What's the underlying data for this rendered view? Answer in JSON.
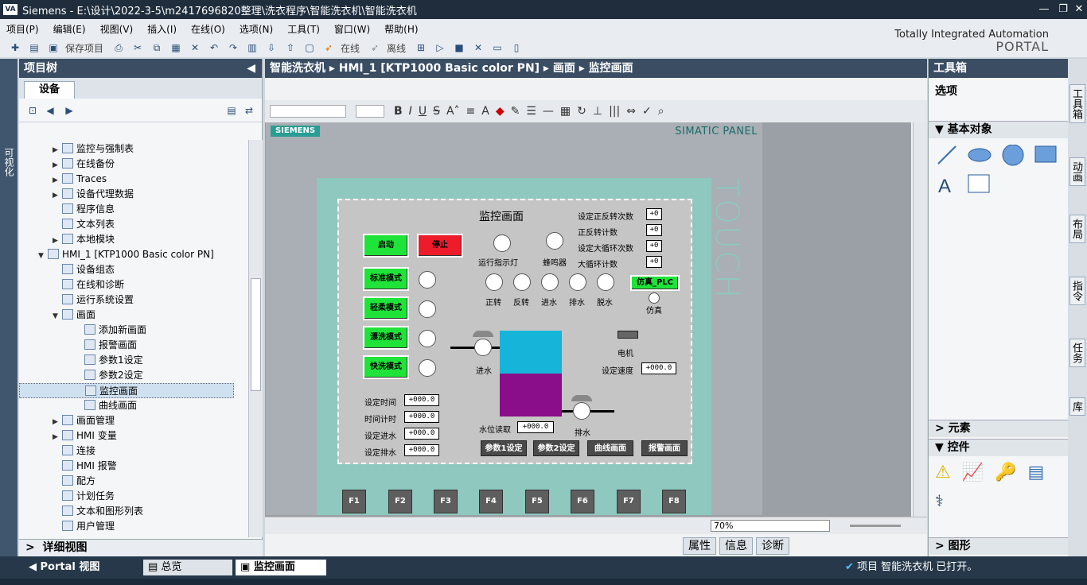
{
  "window": {
    "title": "Siemens  -  E:\\设计\\2022-3-5\\m2417696820整理\\洗衣程序\\智能洗衣机\\智能洗衣机",
    "logo": "VA"
  },
  "menu": [
    "项目(P)",
    "编辑(E)",
    "视图(V)",
    "插入(I)",
    "在线(O)",
    "选项(N)",
    "工具(T)",
    "窗口(W)",
    "帮助(H)"
  ],
  "toolbar": {
    "save_project": "保存项目",
    "online": "在线",
    "offline": "离线"
  },
  "tia": {
    "line1": "Totally Integrated Automation",
    "line2": "PORTAL"
  },
  "left_strip_label": "可视化",
  "project_tree": {
    "title": "项目树",
    "tab": "设备",
    "items": [
      {
        "label": "监控与强制表",
        "level": 2,
        "arrow": "▶"
      },
      {
        "label": "在线备份",
        "level": 2,
        "arrow": "▶"
      },
      {
        "label": "Traces",
        "level": 2,
        "arrow": "▶"
      },
      {
        "label": "设备代理数据",
        "level": 2,
        "arrow": "▶"
      },
      {
        "label": "程序信息",
        "level": 2,
        "arrow": ""
      },
      {
        "label": "文本列表",
        "level": 2,
        "arrow": ""
      },
      {
        "label": "本地模块",
        "level": 2,
        "arrow": "▶"
      },
      {
        "label": "HMI_1 [KTP1000 Basic color PN]",
        "level": 1,
        "arrow": "▼"
      },
      {
        "label": "设备组态",
        "level": 2,
        "arrow": ""
      },
      {
        "label": "在线和诊断",
        "level": 2,
        "arrow": ""
      },
      {
        "label": "运行系统设置",
        "level": 2,
        "arrow": ""
      },
      {
        "label": "画面",
        "level": 2,
        "arrow": "▼"
      },
      {
        "label": "添加新画面",
        "level": 3,
        "arrow": ""
      },
      {
        "label": "报警画面",
        "level": 3,
        "arrow": ""
      },
      {
        "label": "参数1设定",
        "level": 3,
        "arrow": ""
      },
      {
        "label": "参数2设定",
        "level": 3,
        "arrow": ""
      },
      {
        "label": "监控画面",
        "level": 3,
        "arrow": "",
        "selected": true
      },
      {
        "label": "曲线画面",
        "level": 3,
        "arrow": ""
      },
      {
        "label": "画面管理",
        "level": 2,
        "arrow": "▶"
      },
      {
        "label": "HMI 变量",
        "level": 2,
        "arrow": "▶"
      },
      {
        "label": "连接",
        "level": 2,
        "arrow": ""
      },
      {
        "label": "HMI 报警",
        "level": 2,
        "arrow": ""
      },
      {
        "label": "配方",
        "level": 2,
        "arrow": ""
      },
      {
        "label": "计划任务",
        "level": 2,
        "arrow": ""
      },
      {
        "label": "文本和图形列表",
        "level": 2,
        "arrow": ""
      },
      {
        "label": "用户管理",
        "level": 2,
        "arrow": ""
      }
    ]
  },
  "detail_view": "详细视图",
  "breadcrumb": [
    "智能洗衣机",
    "HMI_1 [KTP1000 Basic color PN]",
    "画面",
    "监控画面"
  ],
  "panel": {
    "brand": "SIEMENS",
    "model": "SIMATIC PANEL",
    "touch": "TOUCH",
    "fkeys": [
      "F1",
      "F2",
      "F3",
      "F4",
      "F5",
      "F6",
      "F7",
      "F8"
    ]
  },
  "hmi": {
    "title": "监控画面",
    "btn_start": "启动",
    "btn_stop": "停止",
    "modes": [
      "标准模式",
      "轻柔模式",
      "漂洗模式",
      "快洗模式"
    ],
    "run_light": "运行指示灯",
    "buzzer": "蜂鸣器",
    "states": [
      "正转",
      "反转",
      "进水",
      "排水",
      "脱水"
    ],
    "sim_btn": "仿真_PLC",
    "sim": "仿真",
    "counters": [
      {
        "label": "设定正反转次数",
        "value": "+0"
      },
      {
        "label": "正反转计数",
        "value": "+0"
      },
      {
        "label": "设定大循环次数",
        "value": "+0"
      },
      {
        "label": "大循环计数",
        "value": "+0"
      }
    ],
    "motor": "电机",
    "speed_label": "设定速度",
    "speed_value": "+000.0",
    "inlet": "进水",
    "outlet": "排水",
    "level_label": "水位读取",
    "level_value": "+000.0",
    "params": [
      {
        "label": "设定时间",
        "value": "+000.0"
      },
      {
        "label": "时间计时",
        "value": "+000.0"
      },
      {
        "label": "设定进水",
        "value": "+000.0"
      },
      {
        "label": "设定排水",
        "value": "+000.0"
      }
    ],
    "nav": [
      "参数1设定",
      "参数2设定",
      "曲线画面",
      "报警画面"
    ]
  },
  "zoom": "70%",
  "prop_tabs": [
    "属性",
    "信息",
    "诊断"
  ],
  "toolbox": {
    "title": "工具箱",
    "select": "选项",
    "basic": "基本对象",
    "elements": "元素",
    "controls": "控件",
    "graphics": "图形"
  },
  "right_tabs": [
    "工具箱",
    "动画",
    "布局",
    "指令",
    "任务",
    "库"
  ],
  "bottom": {
    "portal": "Portal 视图",
    "overview": "总览",
    "screen_tab": "监控画面",
    "status": "项目 智能洗衣机 已打开。"
  }
}
